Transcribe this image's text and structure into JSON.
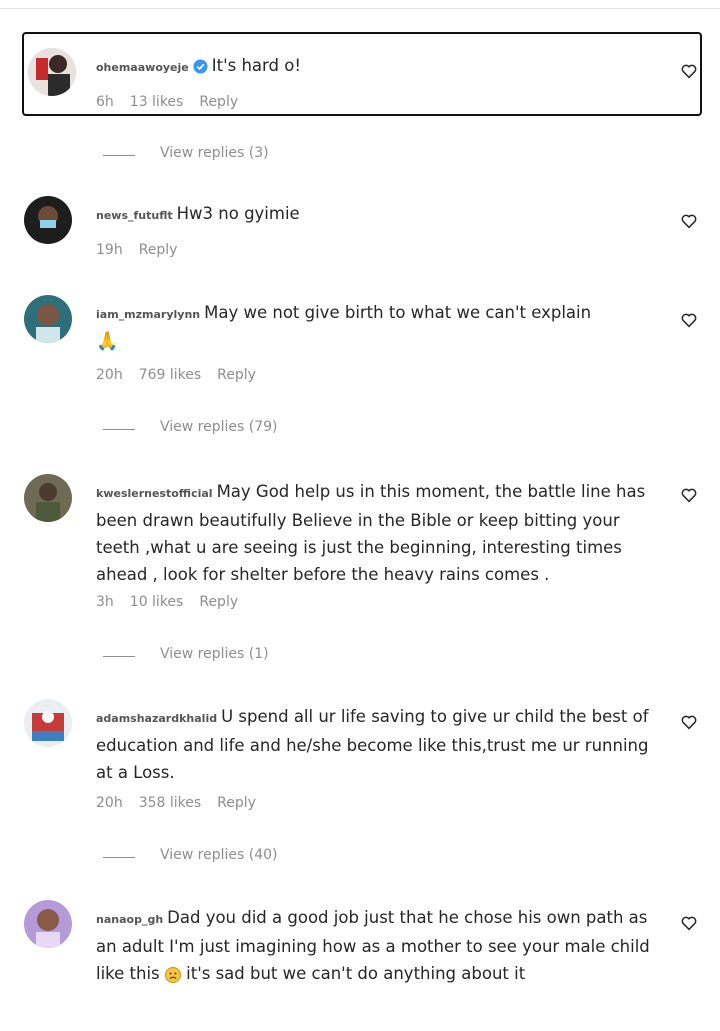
{
  "comments": [
    {
      "username": "ohemaawoyeje",
      "text": "It's hard o!",
      "time": "6h",
      "likes": "13 likes",
      "reply": "Reply",
      "view_replies": "View replies (3)"
    },
    {
      "username": "news_futuflt",
      "text": "Hw3 no gyimie",
      "time": "19h",
      "reply": "Reply"
    },
    {
      "username": "iam_mzmarylynn",
      "text": "May we not give birth to what we can't explain",
      "time": "20h",
      "likes": "769 likes",
      "reply": "Reply",
      "view_replies": "View replies (79)"
    },
    {
      "username": "kweslernestofficial",
      "text": "May God help us in this moment, the battle line has been drawn beautifully Believe in the Bible or keep bitting your teeth ,what u are seeing is just the beginning, interesting times ahead , look for shelter before the heavy rains comes .",
      "time": "3h",
      "likes": "10 likes",
      "reply": "Reply",
      "view_replies": "View replies (1)"
    },
    {
      "username": "adamshazardkhalid",
      "text": "U spend all ur life saving to give ur child the best of education and life and he/she become like this,trust me ur running at a Loss.",
      "time": "20h",
      "likes": "358 likes",
      "reply": "Reply",
      "view_replies": "View replies (40)"
    },
    {
      "username": "nanaop_gh",
      "text_before": "Dad you did a good job just that he chose his own path as an adult I'm just imagining how as a mother to see your male child like this",
      "text_after": "it's sad but we can't do anything about it"
    }
  ],
  "icons": {
    "verified": "verified-badge-icon",
    "like": "heart-outline-icon",
    "prayer": "folded-hands-emoji",
    "sad": "sad-face-emoji"
  },
  "colors": {
    "verified": "#3897f0",
    "secondary_text": "#8e8e8e",
    "primary_text": "#262626"
  }
}
